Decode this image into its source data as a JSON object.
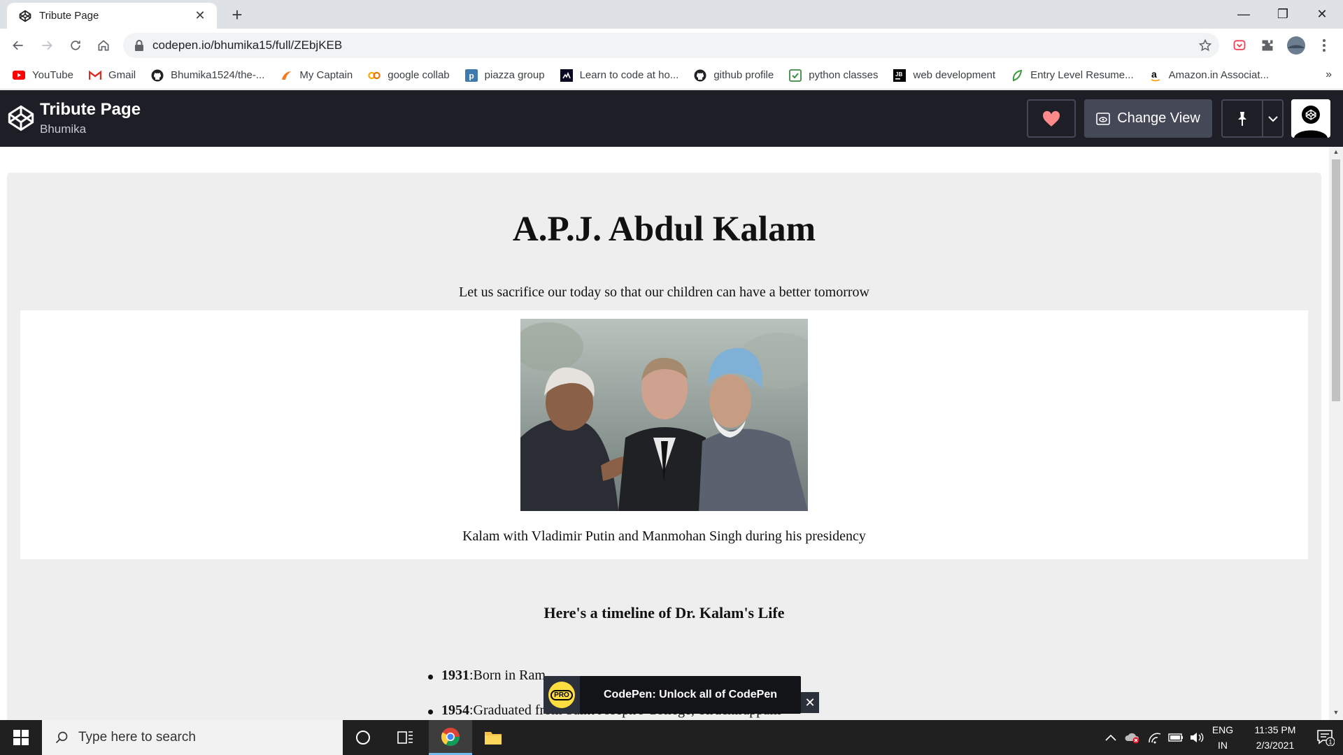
{
  "browser": {
    "tab_title": "Tribute Page",
    "url": "codepen.io/bhumika15/full/ZEbjKEB",
    "bookmarks": [
      {
        "label": "YouTube",
        "icon": "youtube-icon",
        "color": "#ff0000"
      },
      {
        "label": "Gmail",
        "icon": "gmail-icon",
        "color": "#d93025"
      },
      {
        "label": "Bhumika1524/the-...",
        "icon": "github-icon",
        "color": "#202124"
      },
      {
        "label": "My Captain",
        "icon": "mycaptain-icon",
        "color": "#f47b20"
      },
      {
        "label": "google collab",
        "icon": "colab-icon",
        "color": "#f9ab00"
      },
      {
        "label": "piazza group",
        "icon": "piazza-icon",
        "color": "#3e7aab"
      },
      {
        "label": "Learn to code at ho...",
        "icon": "freecodecamp-icon",
        "color": "#0a0a23"
      },
      {
        "label": "github profile",
        "icon": "github-icon",
        "color": "#202124"
      },
      {
        "label": "python classes",
        "icon": "checklist-icon",
        "color": "#3c8d3f"
      },
      {
        "label": "web development",
        "icon": "jetbrains-icon",
        "color": "#000000"
      },
      {
        "label": "Entry Level Resume...",
        "icon": "leaf-icon",
        "color": "#3c9a3c"
      },
      {
        "label": "Amazon.in Associat...",
        "icon": "amazon-icon",
        "color": "#000000"
      }
    ]
  },
  "codepen": {
    "pen_title": "Tribute Page",
    "author": "Bhumika",
    "change_view_label": "Change View"
  },
  "page": {
    "headline": "A.P.J. Abdul Kalam",
    "quote": "Let us sacrifice our today so that our children can have a better tomorrow",
    "image_caption": "Kalam with Vladimir Putin and Manmohan Singh during his presidency",
    "timeline_title": "Here's a timeline of Dr. Kalam's Life",
    "timeline": [
      {
        "year": "1931",
        "text": ":Born in Ram"
      },
      {
        "year": "1954",
        "text": ":Graduated from Saint Joseph's College, Tiruchirappalli"
      }
    ]
  },
  "promo": {
    "badge": "PRO",
    "text": "CodePen: Unlock all of CodePen",
    "close": "✕"
  },
  "taskbar": {
    "search_placeholder": "Type here to search",
    "lang_top": "ENG",
    "lang_bottom": "IN",
    "time": "11:35 PM",
    "date": "2/3/2021",
    "notifications": "1"
  }
}
